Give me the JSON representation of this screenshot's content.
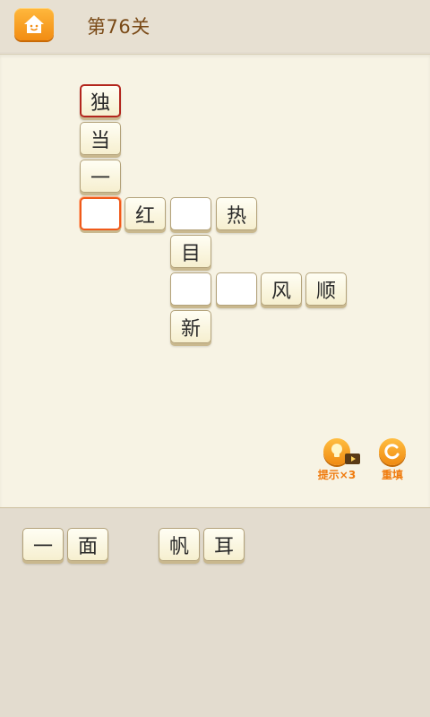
{
  "header": {
    "level_title": "第76关"
  },
  "board": {
    "tiles": [
      {
        "char": "独",
        "state": "given-red"
      },
      {
        "char": "当",
        "state": "given"
      },
      {
        "char": "一",
        "state": "given"
      },
      {
        "char": "",
        "state": "selected"
      },
      {
        "char": "红",
        "state": "given"
      },
      {
        "char": "",
        "state": "blank"
      },
      {
        "char": "热",
        "state": "given"
      },
      {
        "char": "目",
        "state": "given"
      },
      {
        "char": "",
        "state": "blank"
      },
      {
        "char": "",
        "state": "blank"
      },
      {
        "char": "风",
        "state": "given"
      },
      {
        "char": "顺",
        "state": "given"
      },
      {
        "char": "新",
        "state": "given"
      }
    ]
  },
  "tools": {
    "hint_label": "提示×3",
    "reset_label": "重填"
  },
  "answer_bank": [
    "一",
    "面",
    "帆",
    "耳"
  ],
  "colors": {
    "accent": "#f28c12",
    "title": "#7a4a17",
    "board_bg": "#f7f3e4"
  }
}
